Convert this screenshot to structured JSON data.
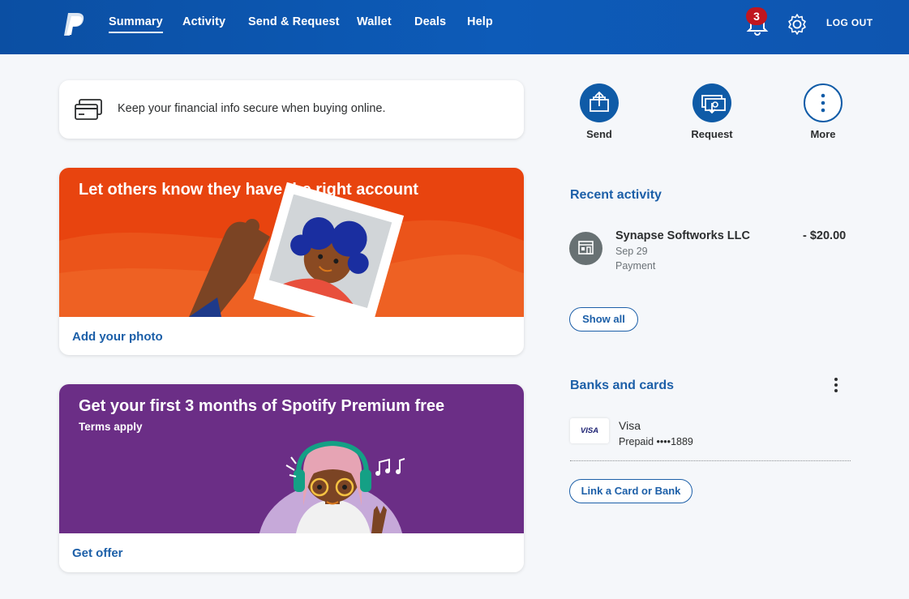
{
  "header": {
    "nav": [
      "Summary",
      "Activity",
      "Send & Request",
      "Wallet",
      "Deals",
      "Help"
    ],
    "active_nav": "Summary",
    "notification_count": "3",
    "logout_label": "LOG OUT"
  },
  "secure_banner": {
    "text": "Keep your financial info secure when buying online."
  },
  "photo_promo": {
    "title": "Let others know they have the right account",
    "link": "Add your photo"
  },
  "spotify_promo": {
    "title": "Get your first 3 months of Spotify Premium free",
    "subtitle": "Terms apply",
    "link": "Get offer"
  },
  "quick_actions": [
    {
      "label": "Send",
      "icon": "send-money-icon"
    },
    {
      "label": "Request",
      "icon": "request-money-icon"
    },
    {
      "label": "More",
      "icon": "more-vertical-icon"
    }
  ],
  "recent_activity": {
    "title": "Recent activity",
    "items": [
      {
        "name": "Synapse Softworks LLC",
        "date": "Sep 29",
        "type": "Payment",
        "amount": "- $20.00"
      }
    ],
    "show_all_label": "Show all"
  },
  "banks_and_cards": {
    "title": "Banks and cards",
    "cards": [
      {
        "brand_logo": "VISA",
        "name": "Visa",
        "detail": "Prepaid ••••1889"
      }
    ],
    "link_label": "Link a Card or Bank"
  },
  "colors": {
    "header_blue": "#0b4fa3",
    "link_blue": "#1c5fa8",
    "photo_promo_orange": "#e8440f",
    "spotify_promo_purple": "#6b2e86",
    "badge_red": "#c0161f"
  }
}
